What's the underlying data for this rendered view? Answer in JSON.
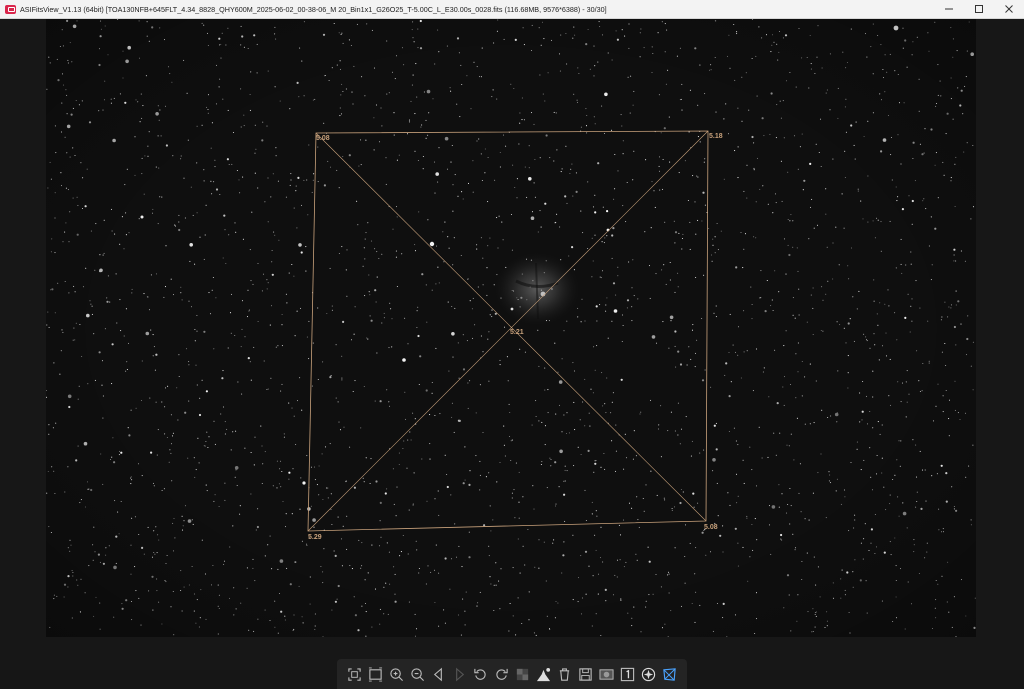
{
  "window": {
    "title": "ASIFitsView_V1.13 (64bit) [TOA130NFB+645FLT_4.34_8828_QHY600M_2025-06-02_00-38-06_M 20_Bin1x1_G26O25_T-5.00C_L_E30.00s_0028.fits (116.68MB, 9576*6388) - 30/30]",
    "controls": [
      "minimize",
      "maximize",
      "close"
    ]
  },
  "overlay": {
    "color": "#c9a27c",
    "labels": {
      "top_left": "5.08",
      "top_right": "5.18",
      "center": "5.21",
      "bottom_left": "5.29",
      "bottom_right": "5.08"
    }
  },
  "toolbar": {
    "buttons": [
      "fit-to-window-icon",
      "actual-size-icon",
      "zoom-in-icon",
      "zoom-out-icon",
      "previous-image-icon",
      "next-image-icon",
      "rotate-left-icon",
      "rotate-right-icon",
      "stretch-icon",
      "histogram-icon",
      "delete-icon",
      "save-icon",
      "compare-icon",
      "one-to-one-icon",
      "star-detect-icon",
      "tilt-analysis-icon"
    ]
  }
}
